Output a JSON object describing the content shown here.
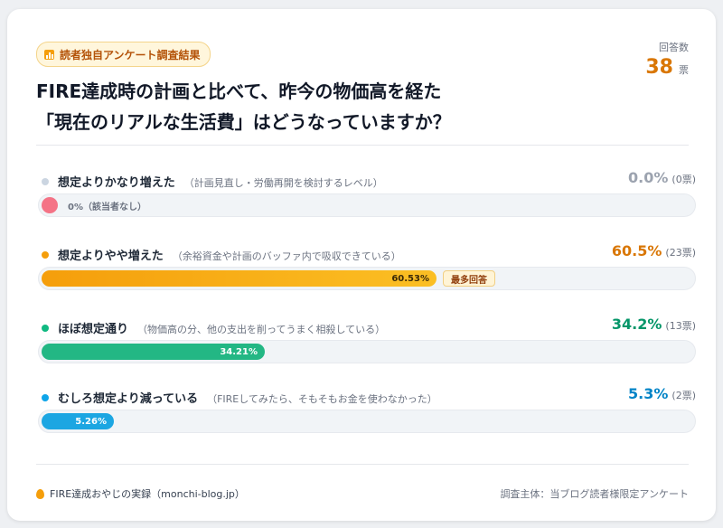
{
  "badge": {
    "icon": "bar-chart-icon",
    "label": "読者独自アンケート調査結果"
  },
  "title": {
    "line1": "FIRE達成時の計画と比べて、昨今の物価高を経た",
    "line2": "「現在のリアルな生活費」はどうなっていますか？"
  },
  "responses": {
    "label": "回答数",
    "count": "38",
    "unit": "票"
  },
  "chart_data": {
    "type": "bar",
    "orientation": "horizontal",
    "value_unit": "%",
    "xlim": [
      0,
      100
    ],
    "total_votes": 38,
    "categories": [
      "想定よりかなり増えた",
      "想定よりやや増えた",
      "ほぼ想定通り",
      "むしろ想定より減っている"
    ],
    "values": [
      0.0,
      60.53,
      34.21,
      5.26
    ],
    "votes": [
      0,
      23,
      13,
      2
    ],
    "items": [
      {
        "label": "想定よりかなり増えた",
        "note": "（計画見直し・労働再開を検討するレベル）",
        "pct_text": "0.0%",
        "votes_text": "(0票)",
        "bar_text": "0%（該当者なし）",
        "value": 0.0,
        "color": "#9ca3af",
        "dot_color": "#cbd5e1"
      },
      {
        "label": "想定よりやや増えた",
        "note": "（余裕資金や計画のバッファ内で吸収できている）",
        "pct_text": "60.5%",
        "votes_text": "(23票)",
        "bar_text": "60.53%",
        "value": 60.53,
        "color": "#d97706",
        "dot_color": "#f59e0b",
        "tag": "最多回答"
      },
      {
        "label": "ほぼ想定通り",
        "note": "（物価高の分、他の支出を削ってうまく相殺している）",
        "pct_text": "34.2%",
        "votes_text": "(13票)",
        "bar_text": "34.21%",
        "value": 34.21,
        "color": "#059669",
        "dot_color": "#10b981"
      },
      {
        "label": "むしろ想定より減っている",
        "note": "（FIREしてみたら、そもそもお金を使わなかった）",
        "pct_text": "5.3%",
        "votes_text": "(2票)",
        "bar_text": "5.26%",
        "value": 5.26,
        "color": "#0284c7",
        "dot_color": "#0ea5e9"
      }
    ]
  },
  "footer": {
    "icon": "flame-icon",
    "source": "FIRE達成おやじの実録（monchi-blog.jp）",
    "sponsor": "調査主体：当ブログ読者様限定アンケート"
  }
}
